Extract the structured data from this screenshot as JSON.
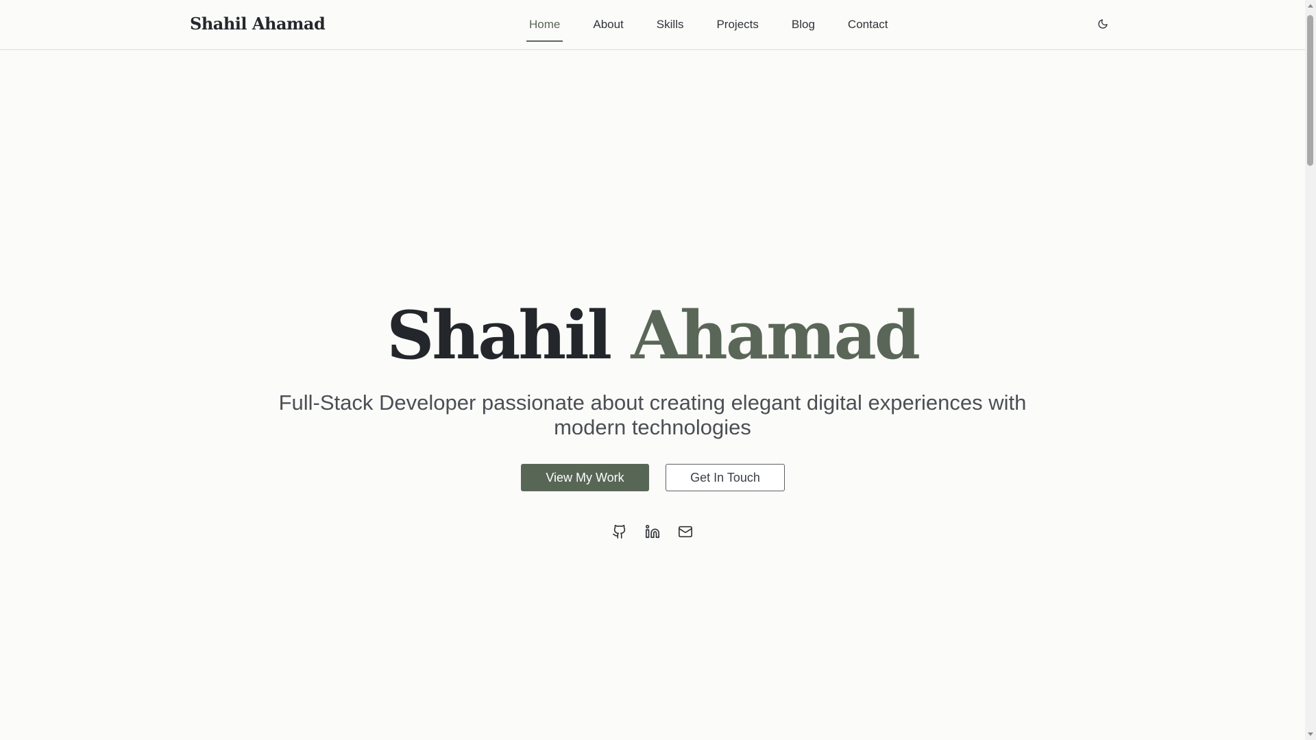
{
  "header": {
    "brand": "Shahil Ahamad",
    "nav": [
      {
        "label": "Home",
        "active": true
      },
      {
        "label": "About",
        "active": false
      },
      {
        "label": "Skills",
        "active": false
      },
      {
        "label": "Projects",
        "active": false
      },
      {
        "label": "Blog",
        "active": false
      },
      {
        "label": "Contact",
        "active": false
      }
    ],
    "theme_toggle_icon": "moon-icon"
  },
  "hero": {
    "first_name": "Shahil",
    "last_name": "Ahamad",
    "subtitle": "Full-Stack Developer passionate about creating elegant digital experiences with modern technologies",
    "primary_button": "View My Work",
    "secondary_button": "Get In Touch",
    "socials": [
      {
        "icon": "github-icon"
      },
      {
        "icon": "linkedin-icon"
      },
      {
        "icon": "mail-icon"
      }
    ]
  },
  "colors": {
    "accent": "#586656",
    "background": "#fbfbf9",
    "text": "#23262a"
  }
}
